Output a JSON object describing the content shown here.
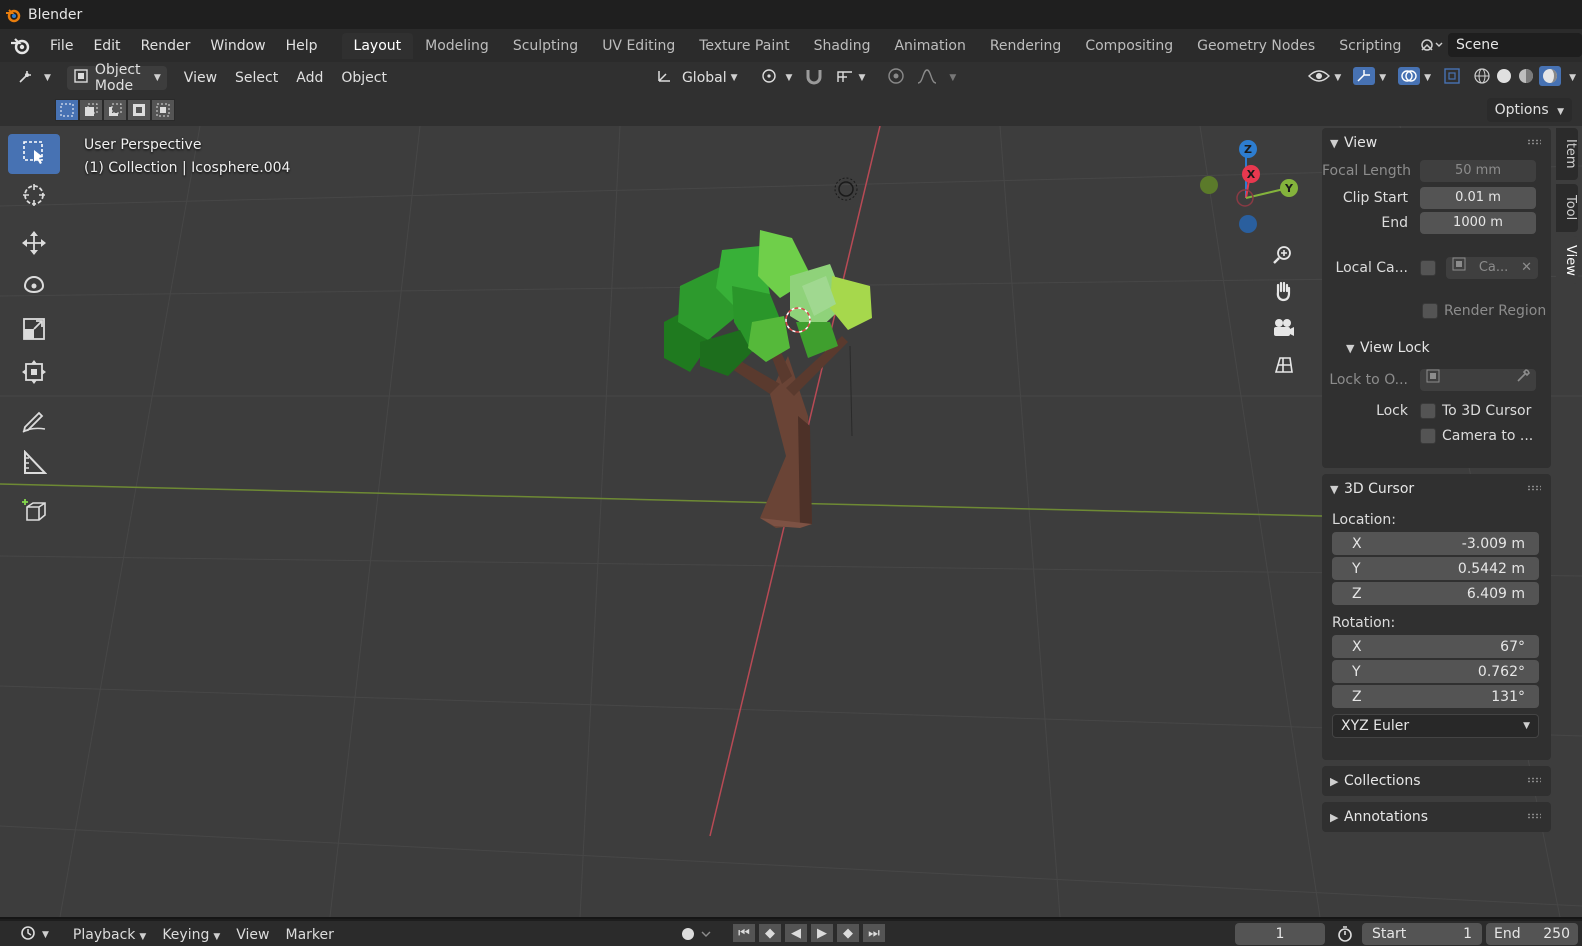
{
  "app": {
    "title": "Blender"
  },
  "menu": {
    "file": "File",
    "edit": "Edit",
    "render": "Render",
    "window": "Window",
    "help": "Help"
  },
  "workspaces": [
    "Layout",
    "Modeling",
    "Sculpting",
    "UV Editing",
    "Texture Paint",
    "Shading",
    "Animation",
    "Rendering",
    "Compositing",
    "Geometry Nodes",
    "Scripting"
  ],
  "active_workspace": "Layout",
  "scene": {
    "name": "Scene"
  },
  "viewport_header": {
    "mode": "Object Mode",
    "view": "View",
    "select": "Select",
    "add": "Add",
    "object": "Object",
    "transform_orientation": "Global",
    "options": "Options"
  },
  "viewport": {
    "perspective": "User Perspective",
    "collection_info": "(1) Collection | Icosphere.004",
    "axis_labels": {
      "x": "X",
      "y": "Y",
      "z": "Z"
    }
  },
  "npanel": {
    "tabs": [
      "Item",
      "Tool",
      "View"
    ],
    "active_tab": "View",
    "view": {
      "title": "View",
      "focal_length_label": "Focal Length",
      "focal_length": "50 mm",
      "clip_start_label": "Clip Start",
      "clip_start": "0.01 m",
      "end_label": "End",
      "end": "1000 m",
      "local_camera_label": "Local Ca...",
      "local_camera_value": "Ca...",
      "render_region_label": "Render Region"
    },
    "view_lock": {
      "title": "View Lock",
      "lock_to_object_label": "Lock to O...",
      "lock_label": "Lock",
      "to_3d_cursor": "To 3D Cursor",
      "camera_to": "Camera to ..."
    },
    "cursor": {
      "title": "3D Cursor",
      "location_label": "Location:",
      "location": [
        {
          "axis": "X",
          "value": "-3.009 m"
        },
        {
          "axis": "Y",
          "value": "0.5442 m"
        },
        {
          "axis": "Z",
          "value": "6.409 m"
        }
      ],
      "rotation_label": "Rotation:",
      "rotation": [
        {
          "axis": "X",
          "value": "67°"
        },
        {
          "axis": "Y",
          "value": "0.762°"
        },
        {
          "axis": "Z",
          "value": "131°"
        }
      ],
      "rotation_mode": "XYZ Euler"
    },
    "collections": "Collections",
    "annotations": "Annotations"
  },
  "timeline": {
    "playback": "Playback",
    "keying": "Keying",
    "view": "View",
    "marker": "Marker",
    "current_frame": "1",
    "start_label": "Start",
    "start": "1",
    "end_label": "End",
    "end": "250"
  },
  "colors": {
    "accent": "#4772b3",
    "x_axis": "#e8384f",
    "y_axis": "#84b33c",
    "z_axis": "#2d7dd0",
    "app_logo": "#e87d0d"
  }
}
